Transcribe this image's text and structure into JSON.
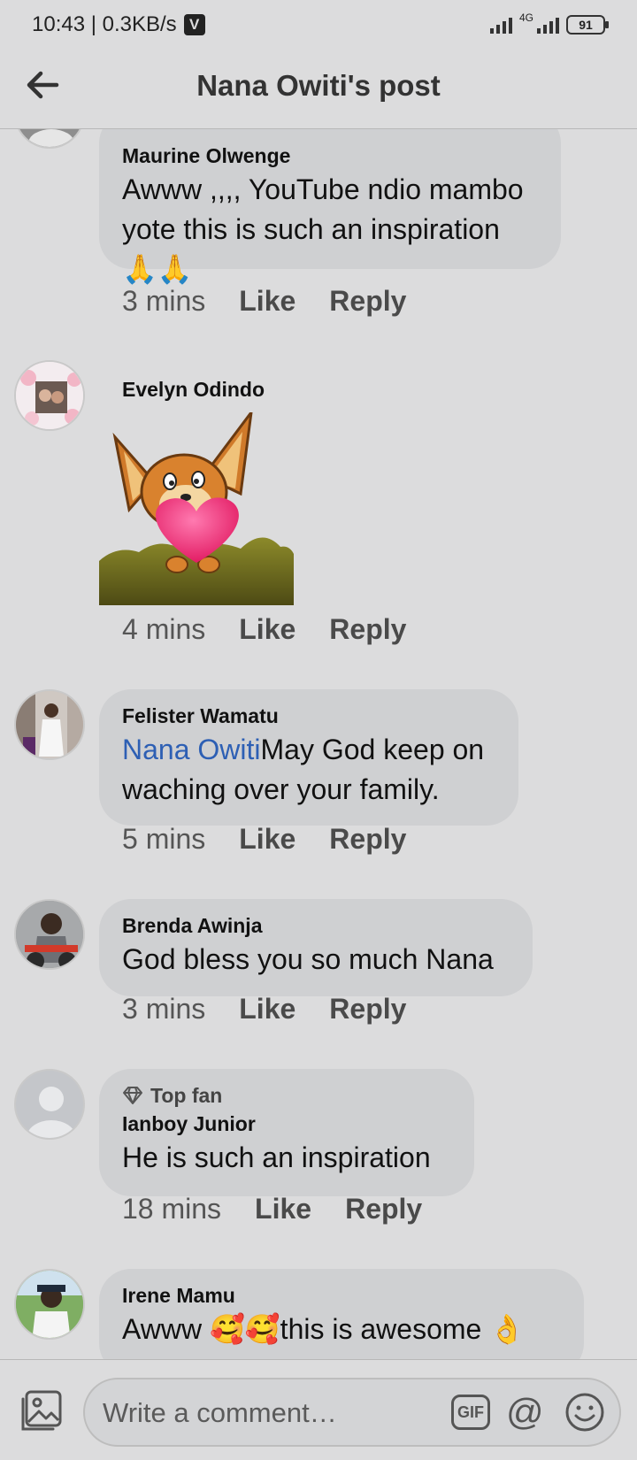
{
  "status_bar": {
    "time": "10:43 | 0.3KB/s",
    "network": "4G",
    "battery": "91"
  },
  "header": {
    "title": "Nana Owiti's post"
  },
  "comments": [
    {
      "author": "Maurine Olwenge",
      "text": "Awww ,,,, YouTube ndio mambo yote this is such an inspiration 🙏🙏",
      "time": "3 mins"
    },
    {
      "author": "Evelyn Odindo",
      "sticker": "dog-holding-heart-sticker",
      "time": "4 mins"
    },
    {
      "author": "Felister Wamatu",
      "mention": "Nana Owiti",
      "text": "May God keep on waching over your family.",
      "time": "5 mins"
    },
    {
      "author": "Brenda Awinja",
      "text": "God bless you so much Nana",
      "time": "3 mins"
    },
    {
      "badge": "Top fan",
      "author": "Ianboy Junior",
      "text": "He is such an inspiration",
      "time": "18 mins"
    },
    {
      "author": "Irene Mamu",
      "text": "Awww 🥰🥰this is awesome 👌"
    }
  ],
  "actions": {
    "like": "Like",
    "reply": "Reply"
  },
  "composer": {
    "placeholder": "Write a comment…",
    "gif": "GIF",
    "at": "@"
  },
  "colors": {
    "background": "#dcdcdd",
    "bubble": "#cfd0d2",
    "mention": "#2d5fb4"
  }
}
